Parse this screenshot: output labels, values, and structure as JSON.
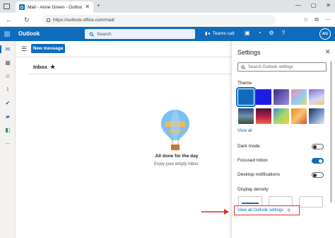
{
  "browser": {
    "tab_title": "Mail - Anne Green - Outlook",
    "tab_close": "✕",
    "new_tab": "+",
    "url": "https://outlook.office.com/mail/",
    "back": "←",
    "refresh": "↻",
    "window_controls": [
      "—",
      "▢",
      "✕"
    ]
  },
  "header": {
    "brand": "Outlook",
    "search_placeholder": "Search",
    "teams_call": "Teams call",
    "avatar_initials": "AG",
    "accent": "#0f6cbd"
  },
  "toolbar": {
    "new_message_label": "New message"
  },
  "mail": {
    "folder_title": "Inbox",
    "empty_title": "All done for the day",
    "empty_subtitle": "Enjoy your empty inbox."
  },
  "settings": {
    "title": "Settings",
    "search_placeholder": "Search Outlook settings",
    "theme_label": "Theme",
    "view_all": "View all",
    "dark_mode": {
      "label": "Dark mode",
      "on": false
    },
    "focused_inbox": {
      "label": "Focused Inbox",
      "on": true
    },
    "desktop_notifications": {
      "label": "Desktop notifications",
      "on": false
    },
    "display_density": "Display density",
    "view_all_settings": "View all Outlook settings"
  }
}
